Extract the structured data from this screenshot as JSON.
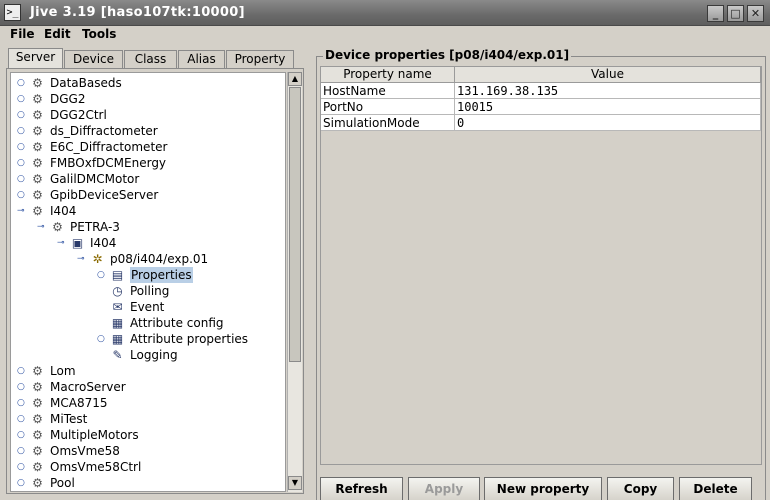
{
  "window": {
    "title": "Jive 3.19  [haso107tk:10000]",
    "app_icon": "terminal-icon",
    "controls": [
      "minimize",
      "maximize",
      "close"
    ]
  },
  "menu": [
    "File",
    "Edit",
    "Tools"
  ],
  "tabs": [
    "Server",
    "Device",
    "Class",
    "Alias",
    "Property"
  ],
  "active_tab": "Server",
  "tree": [
    {
      "label": "DataBaseds",
      "icon": "server-icon",
      "expanded": false
    },
    {
      "label": "DGG2",
      "icon": "server-icon",
      "expanded": false
    },
    {
      "label": "DGG2Ctrl",
      "icon": "server-icon",
      "expanded": false
    },
    {
      "label": "ds_Diffractometer",
      "icon": "server-icon",
      "expanded": false
    },
    {
      "label": "E6C_Diffractometer",
      "icon": "server-icon",
      "expanded": false
    },
    {
      "label": "FMBOxfDCMEnergy",
      "icon": "server-icon",
      "expanded": false
    },
    {
      "label": "GalilDMCMotor",
      "icon": "server-icon",
      "expanded": false
    },
    {
      "label": "GpibDeviceServer",
      "icon": "server-icon",
      "expanded": false
    },
    {
      "label": "I404",
      "icon": "server-icon",
      "expanded": true
    },
    {
      "label": "PETRA-3",
      "icon": "server-icon",
      "expanded": true
    },
    {
      "label": "I404",
      "icon": "class-icon",
      "expanded": true
    },
    {
      "label": "p08/i404/exp.01",
      "icon": "device-icon",
      "expanded": true
    },
    {
      "label": "Properties",
      "icon": "properties-icon",
      "selected": true
    },
    {
      "label": "Polling",
      "icon": "polling-icon"
    },
    {
      "label": "Event",
      "icon": "event-icon"
    },
    {
      "label": "Attribute config",
      "icon": "attribute-config-icon"
    },
    {
      "label": "Attribute properties",
      "icon": "attribute-properties-icon"
    },
    {
      "label": "Logging",
      "icon": "logging-icon"
    },
    {
      "label": "Lom",
      "icon": "server-icon",
      "expanded": false
    },
    {
      "label": "MacroServer",
      "icon": "server-icon",
      "expanded": false
    },
    {
      "label": "MCA8715",
      "icon": "server-icon",
      "expanded": false
    },
    {
      "label": "MiTest",
      "icon": "server-icon",
      "expanded": false
    },
    {
      "label": "MultipleMotors",
      "icon": "server-icon",
      "expanded": false
    },
    {
      "label": "OmsVme58",
      "icon": "server-icon",
      "expanded": false
    },
    {
      "label": "OmsVme58Ctrl",
      "icon": "server-icon",
      "expanded": false
    },
    {
      "label": "Pool",
      "icon": "server-icon",
      "expanded": false
    }
  ],
  "properties_panel": {
    "title": "Device properties [p08/i404/exp.01]",
    "columns": [
      "Property name",
      "Value"
    ],
    "rows": [
      {
        "name": "HostName",
        "value": "131.169.38.135"
      },
      {
        "name": "PortNo",
        "value": "10015"
      },
      {
        "name": "SimulationMode",
        "value": "0"
      }
    ],
    "buttons": [
      {
        "label": "Refresh",
        "enabled": true
      },
      {
        "label": "Apply",
        "enabled": false
      },
      {
        "label": "New property",
        "enabled": true
      },
      {
        "label": "Copy",
        "enabled": true
      },
      {
        "label": "Delete",
        "enabled": true
      }
    ]
  },
  "colors": {
    "titlebar": "#6a6a6a",
    "window_bg": "#d4d0c8",
    "selection": "#b9cfe6",
    "tree_connector": "#2a4fa0"
  }
}
